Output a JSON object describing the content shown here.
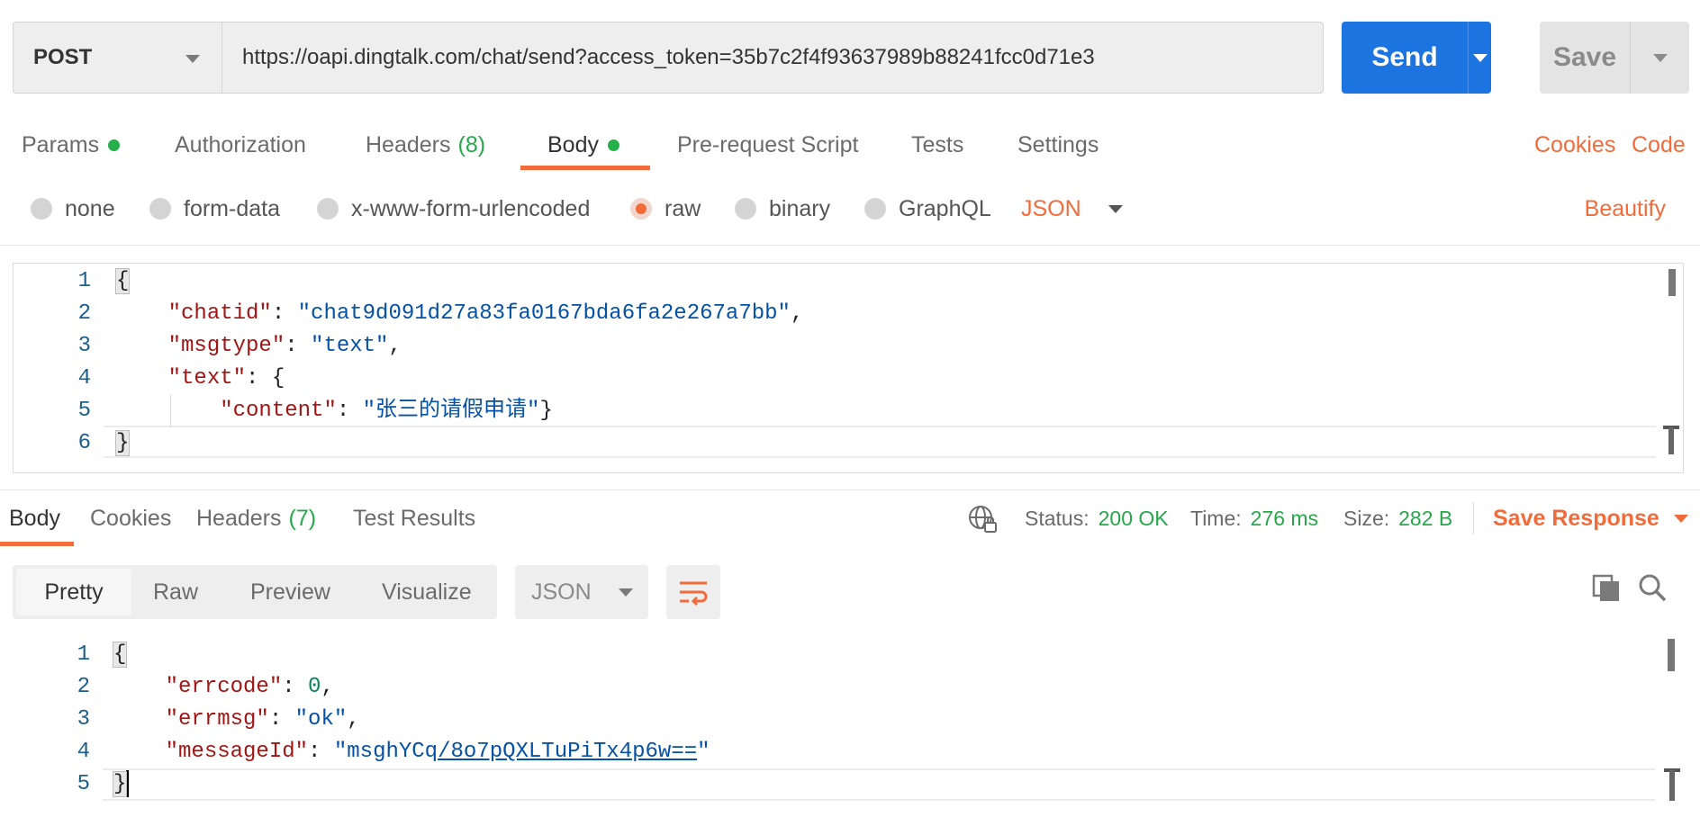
{
  "request": {
    "method": "POST",
    "url": "https://oapi.dingtalk.com/chat/send?access_token=35b7c2f4f93637989b88241fcc0d71e3",
    "send_label": "Send",
    "save_label": "Save"
  },
  "request_tabs": {
    "params": "Params",
    "authorization": "Authorization",
    "headers": "Headers",
    "headers_count": "(8)",
    "body": "Body",
    "prerequest": "Pre-request Script",
    "tests": "Tests",
    "settings": "Settings",
    "cookies": "Cookies",
    "code": "Code"
  },
  "body_types": {
    "none": "none",
    "form_data": "form-data",
    "urlencoded": "x-www-form-urlencoded",
    "raw": "raw",
    "binary": "binary",
    "graphql": "GraphQL",
    "selected": "raw",
    "format": "JSON",
    "beautify": "Beautify"
  },
  "request_body": {
    "line_numbers": [
      "1",
      "2",
      "3",
      "4",
      "5",
      "6"
    ],
    "open_brace": "{",
    "close_brace": "}",
    "k_chatid": "\"chatid\"",
    "v_chatid": "\"chat9d091d27a83fa0167bda6fa2e267a7bb\"",
    "k_msgtype": "\"msgtype\"",
    "v_msgtype": "\"text\"",
    "k_text": "\"text\"",
    "k_content": "\"content\"",
    "v_content": "\"张三的请假申请\""
  },
  "response_tabs": {
    "body": "Body",
    "cookies": "Cookies",
    "headers": "Headers",
    "headers_count": "(7)",
    "test_results": "Test Results"
  },
  "response_status": {
    "status_label": "Status:",
    "status_value": "200 OK",
    "time_label": "Time:",
    "time_value": "276 ms",
    "size_label": "Size:",
    "size_value": "282 B",
    "save_response": "Save Response"
  },
  "response_view": {
    "pretty": "Pretty",
    "raw": "Raw",
    "preview": "Preview",
    "visualize": "Visualize",
    "format": "JSON"
  },
  "response_body": {
    "line_numbers": [
      "1",
      "2",
      "3",
      "4",
      "5"
    ],
    "open_brace": "{",
    "close_brace": "}",
    "k_errcode": "\"errcode\"",
    "v_errcode": "0",
    "k_errmsg": "\"errmsg\"",
    "v_errmsg": "\"ok\"",
    "k_messageid": "\"messageId\"",
    "v_messageid_prefix": "\"msghYCq",
    "v_messageid_link": "/8o7pQXLTuPiTx4p6w==",
    "v_messageid_suffix": "\""
  },
  "colors": {
    "accent": "#f26b3a",
    "send_blue": "#1c74e0",
    "success_green": "#26a84b"
  }
}
